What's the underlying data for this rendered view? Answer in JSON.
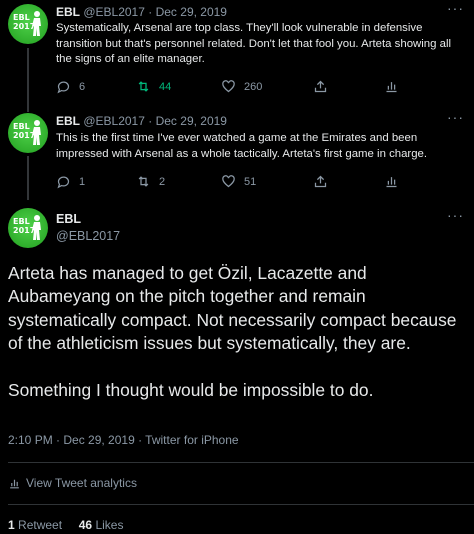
{
  "tweets": [
    {
      "name": "EBL",
      "handle": "@EBL2017",
      "date": "Dec 29, 2019",
      "text": "Systematically, Arsenal are top class. They'll look vulnerable in defensive transition but that's personnel related. Don't let that fool you. Arteta showing all the signs of an elite manager.",
      "replies": "6",
      "retweets": "44",
      "likes": "260",
      "retweeted": true
    },
    {
      "name": "EBL",
      "handle": "@EBL2017",
      "date": "Dec 29, 2019",
      "text": "This is the first time I've ever watched a game at the Emirates and been impressed with Arsenal as a whole tactically. Arteta's first game in charge.",
      "replies": "1",
      "retweets": "2",
      "likes": "51",
      "retweeted": false
    }
  ],
  "main": {
    "name": "EBL",
    "handle": "@EBL2017",
    "paragraphs": [
      "Arteta has managed to get Özil, Lacazette and Aubameyang on the pitch together and remain systematically compact. Not necessarily compact because of the athleticism issues but systematically, they are.",
      "Something I thought would be impossible to do."
    ],
    "meta": "2:10 PM · Dec 29, 2019 · Twitter for iPhone",
    "analytics_label": "View Tweet analytics",
    "retweet_count": "1",
    "retweet_label": "Retweet",
    "like_count": "46",
    "like_label": "Likes"
  },
  "avatar": {
    "text": "EBL 2017",
    "color": "#36b631"
  },
  "separator": "·",
  "colors": {
    "background": "#000000",
    "text": "#e7e9ea",
    "muted": "#8b98a5",
    "retweet_active": "#00ba7c",
    "avatar": "#36b631"
  }
}
